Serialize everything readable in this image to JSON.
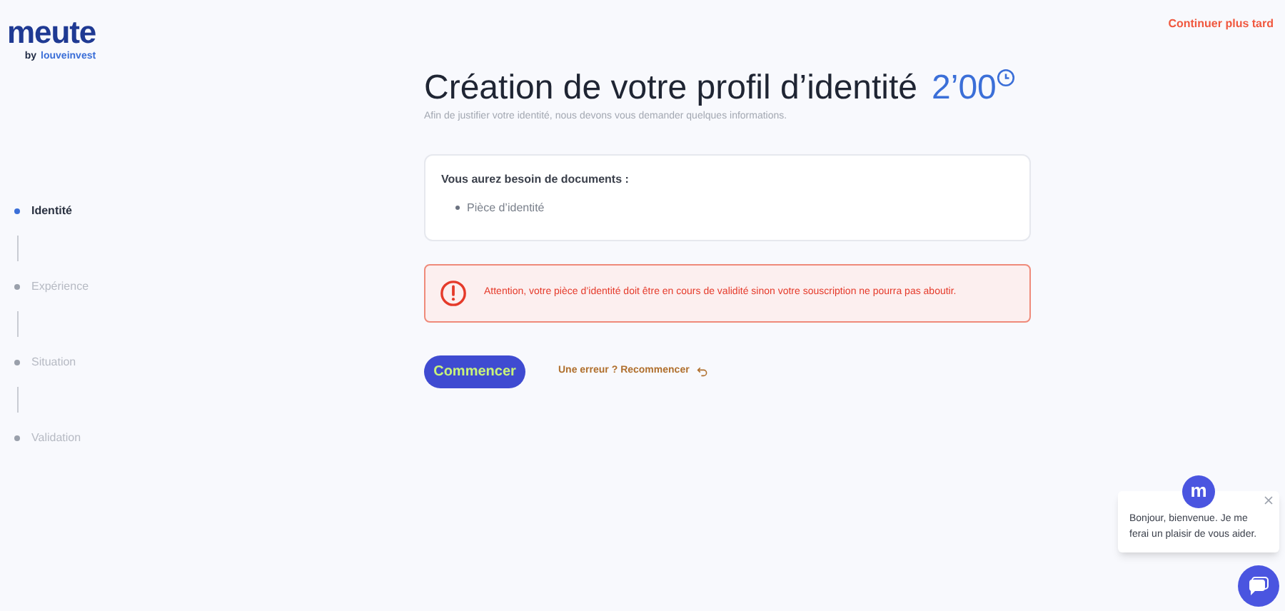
{
  "logo": {
    "name": "meute",
    "by": "by",
    "brand": "louveinvest"
  },
  "header": {
    "later_link": "Continuer plus tard"
  },
  "steps": [
    {
      "label": "Identité",
      "selected": true
    },
    {
      "label": "Expérience",
      "selected": false
    },
    {
      "label": "Situation",
      "selected": false
    },
    {
      "label": "Validation",
      "selected": false
    }
  ],
  "title": "Création de votre profil d’identité",
  "timer": "2’00",
  "subtitle": "Afin de justifier votre identité, nous devons vous demander quelques informations.",
  "documents": {
    "heading": "Vous aurez besoin de documents :",
    "items": [
      "Pièce d’identité"
    ]
  },
  "alert": "Attention, votre pièce d’identité doit être en cours de validité sinon votre souscription ne pourra pas aboutir.",
  "start_button": "Commencer",
  "restart_link": "Une erreur ? Recommencer",
  "chat": {
    "avatar": "m",
    "message": "Bonjour, bienvenue. Je me ferai un plaisir de vous aider."
  }
}
